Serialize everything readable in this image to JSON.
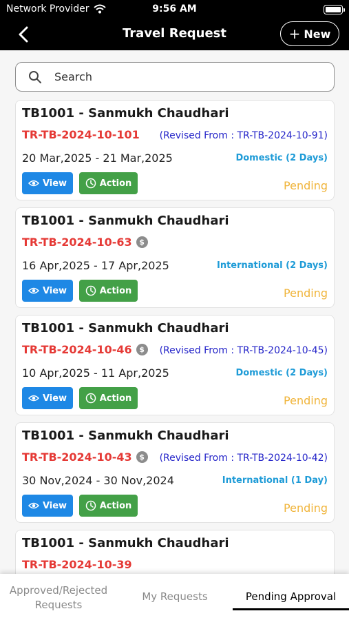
{
  "status_bar": {
    "carrier": "Network Provider",
    "time": "9:56 AM"
  },
  "header": {
    "title": "Travel Request",
    "new_label": "New"
  },
  "search": {
    "placeholder": "Search"
  },
  "cards": [
    {
      "name": "TB1001 - Sanmukh Chaudhari",
      "code": "TR-TB-2024-10-101",
      "has_dollar": false,
      "revised": "(Revised From : TR-TB-2024-10-91)",
      "dates": "20 Mar,2025 - 21 Mar,2025",
      "type": "Domestic (2 Days)",
      "view_label": "View",
      "action_label": "Action",
      "status": "Pending"
    },
    {
      "name": "TB1001 - Sanmukh Chaudhari",
      "code": "TR-TB-2024-10-63",
      "has_dollar": true,
      "revised": "",
      "dates": "16 Apr,2025 - 17 Apr,2025",
      "type": "International (2 Days)",
      "view_label": "View",
      "action_label": "Action",
      "status": "Pending"
    },
    {
      "name": "TB1001 - Sanmukh Chaudhari",
      "code": "TR-TB-2024-10-46",
      "has_dollar": true,
      "revised": "(Revised From : TR-TB-2024-10-45)",
      "dates": "10 Apr,2025 - 11 Apr,2025",
      "type": "Domestic (2 Days)",
      "view_label": "View",
      "action_label": "Action",
      "status": "Pending"
    },
    {
      "name": "TB1001 - Sanmukh Chaudhari",
      "code": "TR-TB-2024-10-43",
      "has_dollar": true,
      "revised": "(Revised From : TR-TB-2024-10-42)",
      "dates": "30 Nov,2024 - 30 Nov,2024",
      "type": "International (1 Day)",
      "view_label": "View",
      "action_label": "Action",
      "status": "Pending"
    },
    {
      "name": "TB1001 - Sanmukh Chaudhari",
      "code": "TR-TB-2024-10-39",
      "has_dollar": false,
      "revised": "",
      "dates": "",
      "type": "",
      "view_label": "",
      "action_label": "",
      "status": ""
    }
  ],
  "dollar_symbol": "$",
  "tabs": [
    {
      "label": "Approved/Rejected\nRequests",
      "active": false
    },
    {
      "label": "My Requests",
      "active": false
    },
    {
      "label": "Pending Approval",
      "active": true
    }
  ],
  "colors": {
    "code": "#e53935",
    "revised": "#2525c9",
    "type": "#1e9bd7",
    "view": "#1e88e5",
    "action": "#43a047",
    "pending": "#f0b43a"
  }
}
